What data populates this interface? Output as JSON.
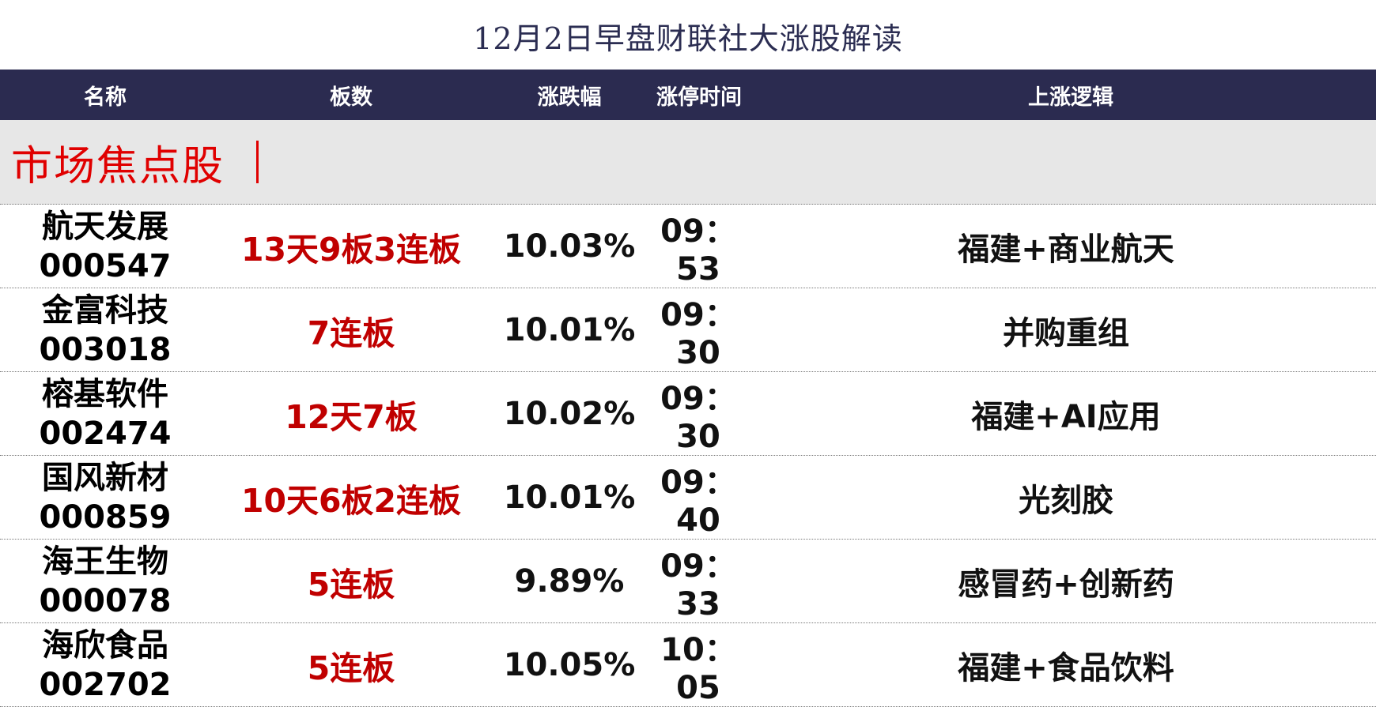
{
  "title": "12月2日早盘财联社大涨股解读",
  "columns": [
    "名称",
    "板数",
    "涨跌幅",
    "涨停时间",
    "上涨逻辑"
  ],
  "section": {
    "label": "市场焦点股"
  },
  "colors": {
    "header_bg": "#2b2b50",
    "accent_red": "#c00000",
    "section_red": "#e00000",
    "section_bg": "#e7e7e7"
  },
  "rows": [
    {
      "name": "航天发展",
      "code": "000547",
      "boards": "13天9板3连板",
      "change": "10.03%",
      "time": "09：53",
      "logic": "福建+商业航天"
    },
    {
      "name": "金富科技",
      "code": "003018",
      "boards": "7连板",
      "change": "10.01%",
      "time": "09：30",
      "logic": "并购重组"
    },
    {
      "name": "榕基软件",
      "code": "002474",
      "boards": "12天7板",
      "change": "10.02%",
      "time": "09：30",
      "logic": "福建+AI应用"
    },
    {
      "name": "国风新材",
      "code": "000859",
      "boards": "10天6板2连板",
      "change": "10.01%",
      "time": "09：40",
      "logic": "光刻胶"
    },
    {
      "name": "海王生物",
      "code": "000078",
      "boards": "5连板",
      "change": "9.89%",
      "time": "09：33",
      "logic": "感冒药+创新药"
    },
    {
      "name": "海欣食品",
      "code": "002702",
      "boards": "5连板",
      "change": "10.05%",
      "time": "10：05",
      "logic": "福建+食品饮料"
    }
  ]
}
